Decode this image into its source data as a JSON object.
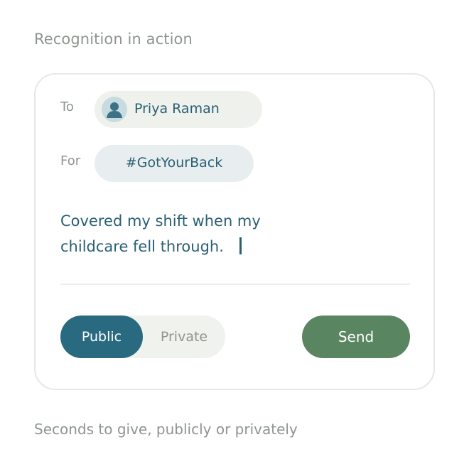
{
  "header": {
    "title": "Recognition in action"
  },
  "form": {
    "to_label": "To",
    "recipient": {
      "name": "Priya Raman",
      "avatar_icon": "person-icon"
    },
    "for_label": "For",
    "tag": "#GotYourBack",
    "message_lines": [
      "Covered my shift when my",
      "childcare fell through."
    ],
    "visibility": {
      "options": [
        "Public",
        "Private"
      ],
      "selected": "Public"
    },
    "send_label": "Send"
  },
  "footer": {
    "caption": "Seconds to give, publicly or privately"
  },
  "colors": {
    "primary_teal": "#2a6a80",
    "send_green": "#5a8561",
    "muted_text": "#8e958f"
  }
}
